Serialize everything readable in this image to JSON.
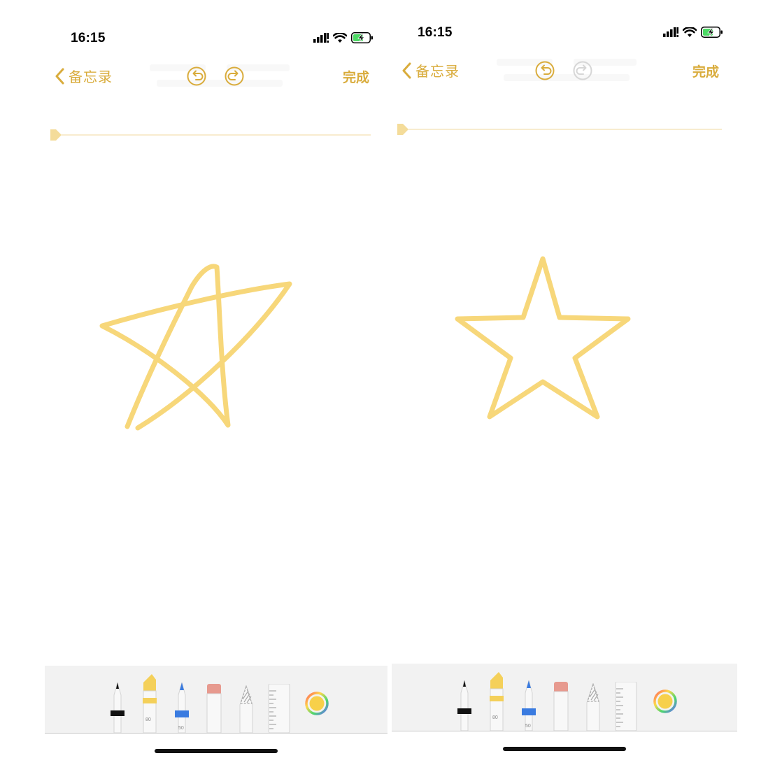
{
  "screens": [
    {
      "status_bar": {
        "time": "16:15"
      },
      "nav": {
        "back_label": "备忘录",
        "done_label": "完成",
        "redo_enabled": true
      },
      "tools": {
        "marker_label": "80",
        "pen_label": "50"
      },
      "drawing": {
        "stroke_color": "#f7d77a",
        "description": "hand-drawn star"
      }
    },
    {
      "status_bar": {
        "time": "16:15"
      },
      "nav": {
        "back_label": "备忘录",
        "done_label": "完成",
        "redo_enabled": false
      },
      "tools": {
        "marker_label": "80",
        "pen_label": "50"
      },
      "drawing": {
        "stroke_color": "#f7d77a",
        "description": "recognized star shape"
      }
    }
  ],
  "colors": {
    "accent": "#d9ac3c",
    "stroke": "#f7d77a",
    "palette_bg": "#f2f2f2"
  }
}
